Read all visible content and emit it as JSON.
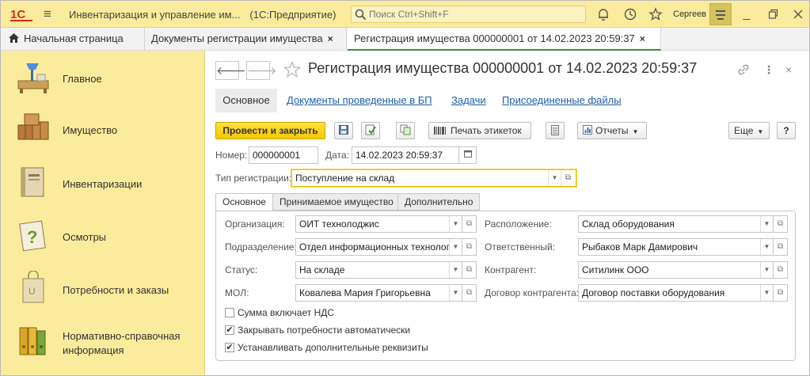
{
  "titlebar": {
    "app_name": "Инвентаризация и управление им...",
    "platform": "(1С:Предприятие)",
    "search_placeholder": "Поиск Ctrl+Shift+F",
    "user": "Сергеев"
  },
  "tabs": [
    {
      "label": "Начальная страница"
    },
    {
      "label": "Документы регистрации имущества",
      "close": "×"
    },
    {
      "label": "Регистрация имущества 000000001 от 14.02.2023 20:59:37",
      "close": "×"
    }
  ],
  "sidebar": {
    "items": [
      {
        "label": "Главное",
        "icon": "main-desk-icon"
      },
      {
        "label": "Имущество",
        "icon": "boxes-icon"
      },
      {
        "label": "Инвентаризации",
        "icon": "book-icon"
      },
      {
        "label": "Осмотры",
        "icon": "question-icon"
      },
      {
        "label": "Потребности и заказы",
        "icon": "bag-icon"
      },
      {
        "label": "Нормативно-справочная",
        "label2": "информация",
        "icon": "binders-icon"
      }
    ]
  },
  "document": {
    "title": "Регистрация имущества 000000001 от 14.02.2023 20:59:37",
    "subnav": [
      "Основное",
      "Документы проведенные в БП",
      "Задачи",
      "Присоединенные файлы"
    ]
  },
  "toolbar": {
    "post_close": "Провести и закрыть",
    "print_labels": "Печать этикеток",
    "reports": "Отчеты",
    "more": "Еще",
    "help": "?"
  },
  "header_fields": {
    "number_label": "Номер:",
    "number": "000000001",
    "date_label": "Дата:",
    "date": "14.02.2023 20:59:37",
    "reg_type_label": "Тип регистрации:",
    "reg_type": "Поступление на склад"
  },
  "inner_tabs": [
    "Основное",
    "Принимаемое имущество",
    "Дополнительно"
  ],
  "form": {
    "org_label": "Организация:",
    "org": "ОИТ технолоджис",
    "dept_label": "Подразделение:",
    "dept": "Отдел информационных технолог",
    "status_label": "Статус:",
    "status": "На складе",
    "mol_label": "МОЛ:",
    "mol": "Ковалева Мария Григорьевна",
    "location_label": "Расположение:",
    "location": "Склад оборудования",
    "responsible_label": "Ответственный:",
    "responsible": "Рыбаков Марк Дамирович",
    "counterparty_label": "Контрагент:",
    "counterparty": "Ситилинк ООО",
    "contract_label": "Договор контрагента:",
    "contract": "Договор поставки оборудования"
  },
  "checkboxes": [
    {
      "label": "Сумма включает НДС",
      "checked": false
    },
    {
      "label": "Закрывать потребности автоматически",
      "checked": true
    },
    {
      "label": "Устанавливать дополнительные реквизиты",
      "checked": true
    }
  ]
}
